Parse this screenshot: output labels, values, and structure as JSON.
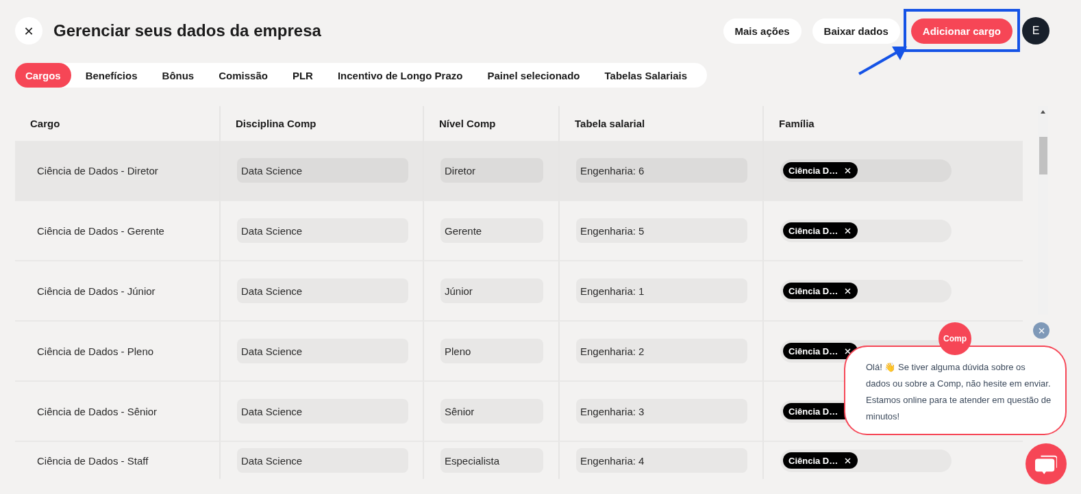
{
  "header": {
    "close_label": "✕",
    "title": "Gerenciar seus dados da empresa",
    "actions": [
      {
        "label": "Mais ações",
        "kind": "secondary",
        "highlighted": false
      },
      {
        "label": "Baixar dados",
        "kind": "secondary",
        "highlighted": false
      },
      {
        "label": "Adicionar cargo",
        "kind": "primary",
        "highlighted": true
      }
    ],
    "avatar": "E"
  },
  "tabs": [
    {
      "label": "Cargos",
      "selected": true
    },
    {
      "label": "Benefícios",
      "selected": false
    },
    {
      "label": "Bônus",
      "selected": false
    },
    {
      "label": "Comissão",
      "selected": false
    },
    {
      "label": "PLR",
      "selected": false
    },
    {
      "label": "Incentivo de Longo Prazo",
      "selected": false
    },
    {
      "label": "Painel selecionado",
      "selected": false
    },
    {
      "label": "Tabelas Salariais",
      "selected": false
    }
  ],
  "table": {
    "columns": [
      "Cargo",
      "Disciplina Comp",
      "Nível Comp",
      "Tabela salarial",
      "Família"
    ],
    "rows": [
      {
        "cargo": "Ciência de Dados - Diretor",
        "disciplina": "Data Science",
        "nivel": "Diretor",
        "tabela": "Engenharia: 6",
        "familia": [
          "Ciência D…"
        ],
        "selected": true
      },
      {
        "cargo": "Ciência de Dados - Gerente",
        "disciplina": "Data Science",
        "nivel": "Gerente",
        "tabela": "Engenharia: 5",
        "familia": [
          "Ciência D…"
        ],
        "selected": false
      },
      {
        "cargo": "Ciência de Dados - Júnior",
        "disciplina": "Data Science",
        "nivel": "Júnior",
        "tabela": "Engenharia: 1",
        "familia": [
          "Ciência D…"
        ],
        "selected": false
      },
      {
        "cargo": "Ciência de Dados - Pleno",
        "disciplina": "Data Science",
        "nivel": "Pleno",
        "tabela": "Engenharia: 2",
        "familia": [
          "Ciência D…"
        ],
        "selected": false
      },
      {
        "cargo": "Ciência de Dados - Sênior",
        "disciplina": "Data Science",
        "nivel": "Sênior",
        "tabela": "Engenharia: 3",
        "familia": [
          "Ciência D…"
        ],
        "selected": false
      },
      {
        "cargo": "Ciência de Dados - Staff",
        "disciplina": "Data Science",
        "nivel": "Especialista",
        "tabela": "Engenharia: 4",
        "familia": [
          "Ciência D…"
        ],
        "selected": false
      }
    ]
  },
  "chat": {
    "badge": "Comp",
    "message": "Olá! 👋 Se tiver alguma dúvida sobre os dados ou sobre a Comp, não hesite em enviar. Estamos online para te atender em questão de minutos!"
  }
}
